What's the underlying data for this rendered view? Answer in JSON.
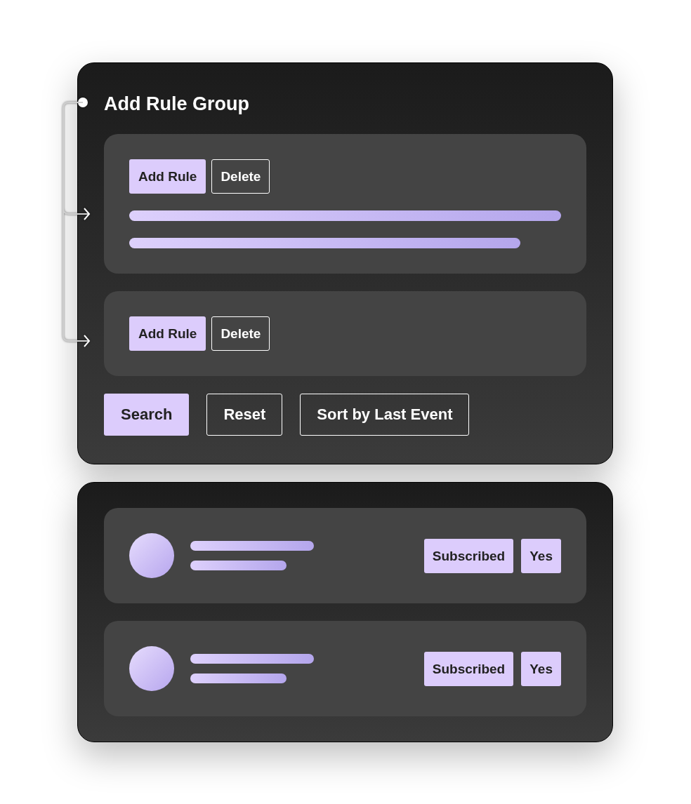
{
  "rule_builder": {
    "title": "Add Rule Group",
    "rule_groups": [
      {
        "expanded": true,
        "buttons": [
          {
            "label": "Add Rule",
            "kind": "primary"
          },
          {
            "label": "Delete",
            "kind": "outline"
          }
        ]
      },
      {
        "expanded": false,
        "buttons": [
          {
            "label": "Add Rule",
            "kind": "primary"
          },
          {
            "label": "Delete",
            "kind": "outline"
          }
        ]
      }
    ],
    "actions": [
      {
        "label": "Search",
        "kind": "primary"
      },
      {
        "label": "Reset",
        "kind": "outline"
      },
      {
        "label": "Sort by Last Event",
        "kind": "outline"
      }
    ]
  },
  "results": [
    {
      "badges": [
        "Subscribed",
        "Yes"
      ]
    },
    {
      "badges": [
        "Subscribed",
        "Yes"
      ]
    }
  ]
}
